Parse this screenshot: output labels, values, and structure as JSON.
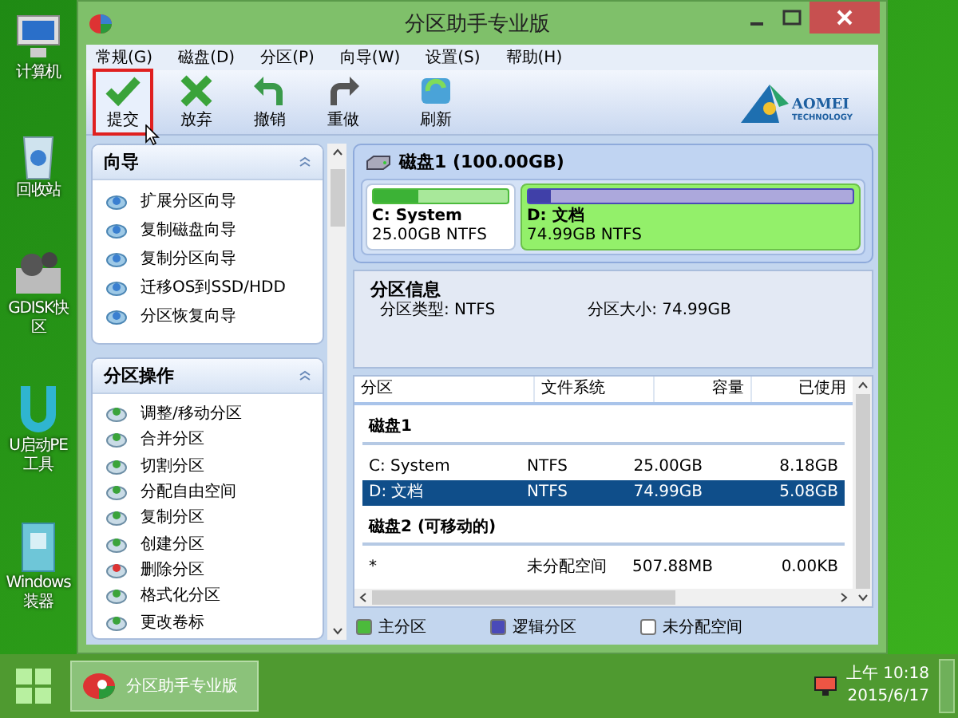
{
  "desktop_icons": [
    {
      "kind": "computer",
      "lines": [
        "计算机"
      ]
    },
    {
      "kind": "bin",
      "lines": [
        "回收站"
      ]
    },
    {
      "kind": "gears",
      "lines": [
        "GDISK快",
        "区"
      ]
    },
    {
      "kind": "u",
      "lines": [
        "U启动PE",
        "工具"
      ]
    },
    {
      "kind": "box",
      "lines": [
        "Windows",
        "装器"
      ]
    }
  ],
  "window": {
    "title": "分区助手专业版",
    "menu": [
      "常规(G)",
      "磁盘(D)",
      "分区(P)",
      "向导(W)",
      "设置(S)",
      "帮助(H)"
    ],
    "toolbar": [
      {
        "label": "提交",
        "kind": "check",
        "highlighted": true
      },
      {
        "label": "放弃",
        "kind": "cross",
        "highlighted": false
      },
      {
        "label": "撤销",
        "kind": "undo",
        "highlighted": false
      },
      {
        "label": "重做",
        "kind": "redo",
        "highlighted": false
      },
      {
        "label": "刷新",
        "kind": "refresh",
        "highlighted": false
      }
    ],
    "logo": {
      "name": "AOMEI",
      "sub": "TECHNOLOGY"
    }
  },
  "wizard": {
    "title": "向导",
    "items": [
      "扩展分区向导",
      "复制磁盘向导",
      "复制分区向导",
      "迁移OS到SSD/HDD",
      "分区恢复向导"
    ]
  },
  "operations": {
    "title": "分区操作",
    "items": [
      "调整/移动分区",
      "合并分区",
      "切割分区",
      "分配自由空间",
      "复制分区",
      "创建分区",
      "删除分区",
      "格式化分区",
      "更改卷标"
    ]
  },
  "disk_map": {
    "title": "磁盘1 (100.00GB)",
    "partitions": [
      {
        "name": "C: System",
        "detail": "25.00GB NTFS",
        "kind": "primary",
        "level": 0.33,
        "selected": false
      },
      {
        "name": "D: 文档",
        "detail": "74.99GB NTFS",
        "kind": "logical",
        "level": 0.07,
        "selected": true
      }
    ]
  },
  "info": {
    "title": "分区信息",
    "fields": [
      "分区类型: NTFS",
      "分区大小: 74.99GB"
    ]
  },
  "table": {
    "columns": [
      "分区",
      "文件系统",
      "容量",
      "已使用"
    ],
    "rows": [
      {
        "kind": "group",
        "cells": [
          "磁盘1"
        ]
      },
      {
        "kind": "partition",
        "cells": [
          "C: System",
          "NTFS",
          "25.00GB",
          "8.18GB"
        ],
        "selected": false
      },
      {
        "kind": "partition",
        "cells": [
          "D: 文档",
          "NTFS",
          "74.99GB",
          "5.08GB"
        ],
        "selected": true
      },
      {
        "kind": "group",
        "cells": [
          "磁盘2 (可移动的)"
        ]
      },
      {
        "kind": "partition",
        "cells": [
          "*",
          "未分配空间",
          "507.88MB",
          "0.00KB"
        ],
        "selected": false
      }
    ]
  },
  "legend": [
    {
      "label": "主分区",
      "color": "#4cbb3c"
    },
    {
      "label": "逻辑分区",
      "color": "#4a4ab8"
    },
    {
      "label": "未分配空间",
      "color": "#ffffff"
    }
  ],
  "taskbar": {
    "task": "分区助手专业版",
    "time": "上午 10:18",
    "date": "2015/6/17"
  }
}
